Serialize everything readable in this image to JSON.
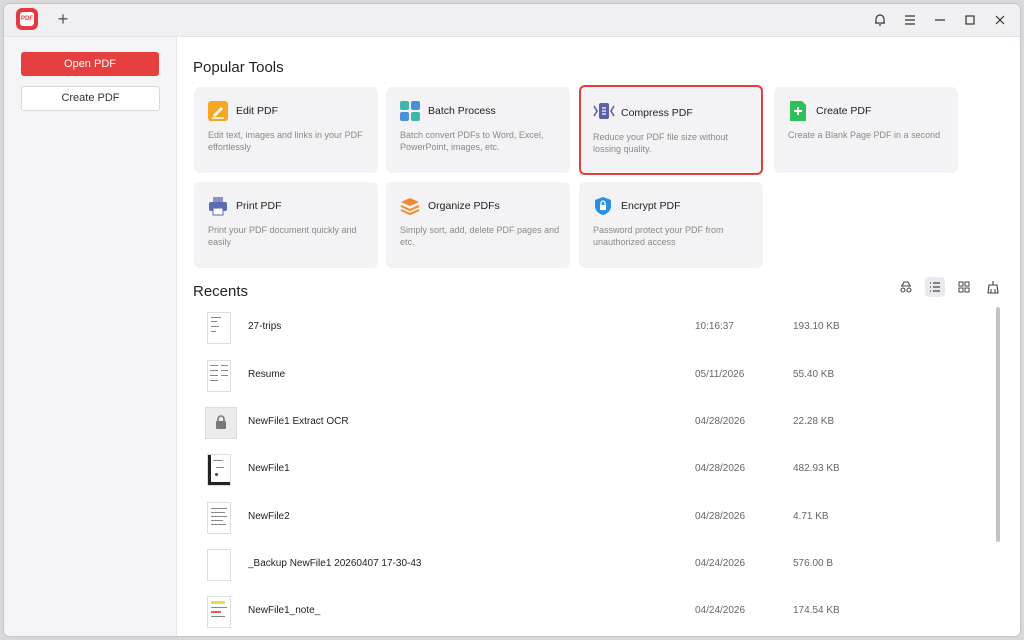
{
  "titlebar": {
    "logo_text": "PDF",
    "new_tab_label": "+"
  },
  "sidebar": {
    "open_pdf": "Open PDF",
    "create_pdf": "Create PDF"
  },
  "popular_tools": {
    "title": "Popular Tools",
    "tools": [
      {
        "name": "Edit PDF",
        "desc": "Edit text, images and links in your PDF effortlessly",
        "icon": "edit-icon",
        "color": "#f5a623"
      },
      {
        "name": "Batch Process",
        "desc": "Batch convert PDFs to Word, Excel, PowerPoint, images, etc.",
        "icon": "batch-icon",
        "color": "#3fb7a8"
      },
      {
        "name": "Compress PDF",
        "desc": "Reduce your PDF file size without lossing quality.",
        "icon": "compress-icon",
        "color": "#5b5fa8"
      },
      {
        "name": "Create PDF",
        "desc": "Create a Blank Page PDF in a second",
        "icon": "create-icon",
        "color": "#2fbf5b"
      },
      {
        "name": "Print PDF",
        "desc": "Print your PDF document quickly and easily",
        "icon": "print-icon",
        "color": "#5a6bb0"
      },
      {
        "name": "Organize PDFs",
        "desc": "Simply sort, add, delete PDF pages and etc.",
        "icon": "organize-icon",
        "color": "#f08a2c"
      },
      {
        "name": "Encrypt PDF",
        "desc": "Password protect your PDF from unauthorized access",
        "icon": "encrypt-icon",
        "color": "#2a8fe0"
      }
    ]
  },
  "recents": {
    "title": "Recents",
    "files": [
      {
        "name": "27-trips",
        "date": "10:16:37",
        "size": "193.10 KB"
      },
      {
        "name": "Resume",
        "date": "05/11/2026",
        "size": "55.40 KB"
      },
      {
        "name": "NewFile1 Extract OCR",
        "date": "04/28/2026",
        "size": "22.28 KB"
      },
      {
        "name": "NewFile1",
        "date": "04/28/2026",
        "size": "482.93 KB"
      },
      {
        "name": "NewFile2",
        "date": "04/28/2026",
        "size": "4.71 KB"
      },
      {
        "name": "_Backup NewFile1 20260407 17-30-43",
        "date": "04/24/2026",
        "size": "576.00 B"
      },
      {
        "name": "NewFile1_note_",
        "date": "04/24/2026",
        "size": "174.54 KB"
      }
    ]
  },
  "colors": {
    "accent": "#e5403f",
    "selected_border": "#e0403a"
  }
}
